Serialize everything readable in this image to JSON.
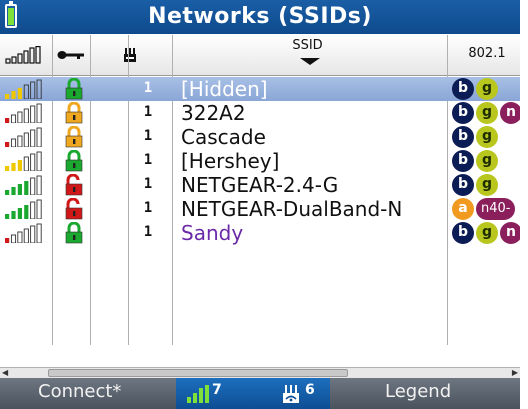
{
  "title": "Networks (SSIDs)",
  "header": {
    "ssid": "SSID",
    "standards": "802.1"
  },
  "networks": [
    {
      "ssid": "[Hidden]",
      "channel": "1",
      "signal_bars": 3,
      "signal_color": "#f0c800",
      "lock_color": "#1aa82e",
      "lock_open": false,
      "badges": [
        "b",
        "g"
      ],
      "selected": true,
      "ssid_color": "#ffffff"
    },
    {
      "ssid": "322A2",
      "channel": "1",
      "signal_bars": 1,
      "signal_color": "#d01818",
      "lock_color": "#f0a820",
      "lock_open": false,
      "badges": [
        "b",
        "g",
        "n"
      ],
      "selected": false,
      "ssid_color": "#111111"
    },
    {
      "ssid": "Cascade",
      "channel": "1",
      "signal_bars": 1,
      "signal_color": "#d01818",
      "lock_color": "#f0a820",
      "lock_open": false,
      "badges": [
        "b",
        "g"
      ],
      "selected": false,
      "ssid_color": "#111111"
    },
    {
      "ssid": "[Hershey]",
      "channel": "1",
      "signal_bars": 3,
      "signal_color": "#f0c800",
      "lock_color": "#1aa82e",
      "lock_open": false,
      "badges": [
        "b",
        "g"
      ],
      "selected": false,
      "ssid_color": "#111111"
    },
    {
      "ssid": "NETGEAR-2.4-G",
      "channel": "1",
      "signal_bars": 4,
      "signal_color": "#1aa82e",
      "lock_color": "#d01818",
      "lock_open": true,
      "badges": [
        "b",
        "g"
      ],
      "selected": false,
      "ssid_color": "#111111"
    },
    {
      "ssid": "NETGEAR-DualBand-N",
      "channel": "1",
      "signal_bars": 4,
      "signal_color": "#1aa82e",
      "lock_color": "#d01818",
      "lock_open": true,
      "badges": [
        "a",
        "n40-"
      ],
      "selected": false,
      "ssid_color": "#111111"
    },
    {
      "ssid": "Sandy",
      "channel": "1",
      "signal_bars": 1,
      "signal_color": "#d01818",
      "lock_color": "#1aa82e",
      "lock_open": false,
      "badges": [
        "b",
        "g",
        "n"
      ],
      "selected": false,
      "ssid_color": "#6a2aa8"
    }
  ],
  "softkeys": {
    "connect": "Connect*",
    "signal_count": "7",
    "ap_count": "6",
    "legend": "Legend"
  },
  "colors": {
    "title_bar": "#1a5ea6",
    "selection": "#98b2de",
    "softkey_bar": "#5a636d"
  }
}
